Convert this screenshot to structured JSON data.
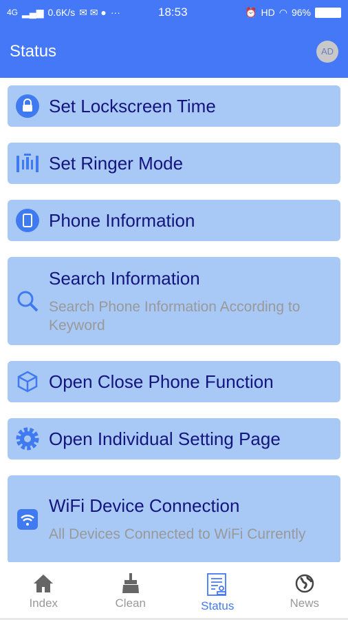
{
  "status_bar": {
    "network": "4G",
    "speed": "0.6K/s",
    "time": "18:53",
    "hd": "HD",
    "battery": "96%"
  },
  "header": {
    "title": "Status",
    "avatar": "AD"
  },
  "items": [
    {
      "title": "Set Lockscreen Time",
      "icon": "lock-icon"
    },
    {
      "title": "Set Ringer Mode",
      "icon": "ringer-icon"
    },
    {
      "title": "Phone Information",
      "icon": "phone-icon"
    },
    {
      "title": "Search Information",
      "subtitle": "Search Phone Information According to Keyword",
      "icon": "search-icon"
    },
    {
      "title": "Open Close Phone Function",
      "icon": "cube-icon"
    },
    {
      "title": "Open Individual Setting Page",
      "icon": "gear-icon"
    },
    {
      "title": "WiFi Device Connection",
      "subtitle": "All Devices Connected to WiFi Currently",
      "icon": "wifi-icon"
    }
  ],
  "nav": [
    {
      "label": "Index",
      "icon": "home-icon"
    },
    {
      "label": "Clean",
      "icon": "broom-icon"
    },
    {
      "label": "Status",
      "icon": "document-icon",
      "active": true
    },
    {
      "label": "News",
      "icon": "globe-icon"
    }
  ],
  "colors": {
    "primary": "#4478f6",
    "card": "#a8c8f6",
    "title_text": "#14147f"
  }
}
